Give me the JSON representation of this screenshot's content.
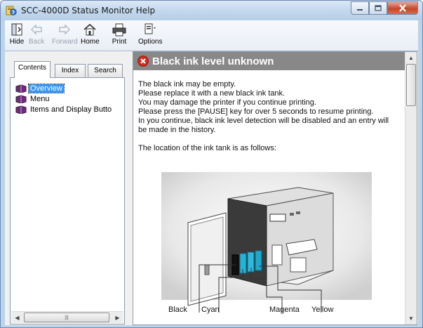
{
  "window": {
    "title": "SCC-4000D Status Monitor Help"
  },
  "toolbar": {
    "hide": "Hide",
    "back": "Back",
    "forward": "Forward",
    "home": "Home",
    "print": "Print",
    "options": "Options"
  },
  "nav": {
    "tabs": [
      "Contents",
      "Index",
      "Search"
    ],
    "active_tab": "Contents",
    "items": [
      {
        "label": "Overview",
        "selected": true
      },
      {
        "label": "Menu",
        "selected": false
      },
      {
        "label": "Items and Display Butto",
        "selected": false
      }
    ]
  },
  "doc": {
    "title": "Black ink level unknown",
    "lines": [
      "The black ink may be empty.",
      "Please replace it with a new black ink tank.",
      "You may damage the printer if you continue printing.",
      "Please press the [PAUSE] key for over 5 seconds to resume printing.",
      "In you continue, black ink level detection will be disabled and an entry will",
      "be made in the history."
    ],
    "location_text": "The location of the ink tank is as follows:",
    "figure_labels": {
      "black": "Black",
      "cyan": "Cyan",
      "magenta": "Magenta",
      "yellow": "Yellow"
    }
  },
  "colors": {
    "header_bg": "#888888",
    "selection": "#3399ff",
    "error_red": "#d9291c"
  },
  "icons": [
    "hide-icon",
    "back-icon",
    "forward-icon",
    "home-icon",
    "print-icon",
    "options-icon",
    "book-icon",
    "error-icon"
  ]
}
